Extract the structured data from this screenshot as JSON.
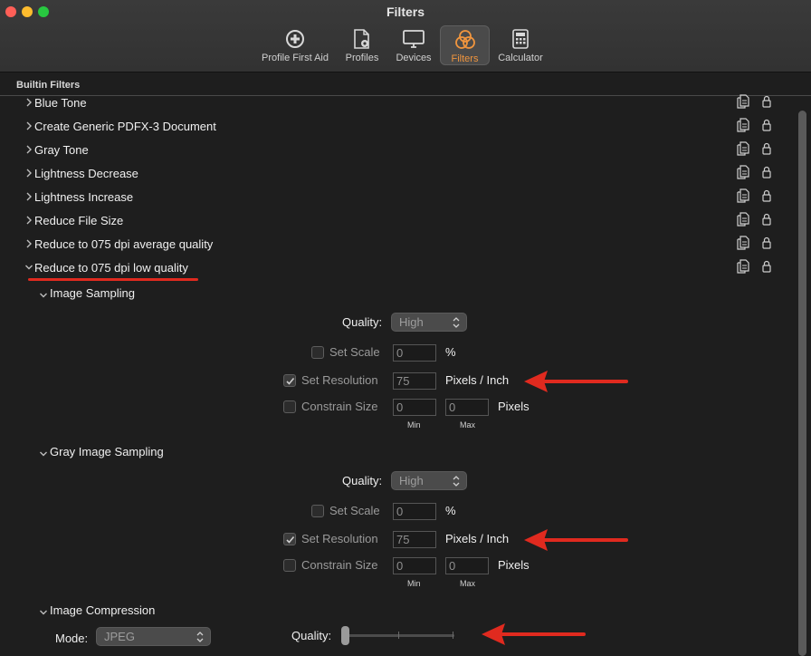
{
  "window": {
    "title": "Filters"
  },
  "toolbar": {
    "items": [
      {
        "label": "Profile First Aid",
        "icon": "plus-circle-icon"
      },
      {
        "label": "Profiles",
        "icon": "document-gear-icon"
      },
      {
        "label": "Devices",
        "icon": "monitor-icon"
      },
      {
        "label": "Filters",
        "icon": "filters-circles-icon",
        "active": true
      },
      {
        "label": "Calculator",
        "icon": "calculator-icon"
      }
    ],
    "accent_color": "#f0953e"
  },
  "section": {
    "title": "Builtin Filters"
  },
  "filters": [
    {
      "name": "Blue Tone",
      "expanded": false
    },
    {
      "name": "Create Generic PDFX-3 Document",
      "expanded": false
    },
    {
      "name": "Gray Tone",
      "expanded": false
    },
    {
      "name": "Lightness Decrease",
      "expanded": false
    },
    {
      "name": "Lightness Increase",
      "expanded": false
    },
    {
      "name": "Reduce File Size",
      "expanded": false
    },
    {
      "name": "Reduce to 075 dpi average quality",
      "expanded": false
    },
    {
      "name": "Reduce to 075 dpi low quality",
      "expanded": true
    }
  ],
  "image_sampling": {
    "title": "Image Sampling",
    "quality_label": "Quality:",
    "quality_value": "High",
    "set_scale_label": "Set Scale",
    "set_scale_checked": false,
    "set_scale_value": "0",
    "set_scale_unit": "%",
    "set_resolution_label": "Set Resolution",
    "set_resolution_checked": true,
    "set_resolution_value": "75",
    "set_resolution_unit": "Pixels / Inch",
    "constrain_label": "Constrain Size",
    "constrain_checked": false,
    "constrain_min": "0",
    "constrain_max": "0",
    "constrain_unit": "Pixels",
    "min_label": "Min",
    "max_label": "Max"
  },
  "gray_image_sampling": {
    "title": "Gray Image Sampling",
    "quality_label": "Quality:",
    "quality_value": "High",
    "set_scale_label": "Set Scale",
    "set_scale_checked": false,
    "set_scale_value": "0",
    "set_scale_unit": "%",
    "set_resolution_label": "Set Resolution",
    "set_resolution_checked": true,
    "set_resolution_value": "75",
    "set_resolution_unit": "Pixels / Inch",
    "constrain_label": "Constrain Size",
    "constrain_checked": false,
    "constrain_min": "0",
    "constrain_max": "0",
    "constrain_unit": "Pixels",
    "min_label": "Min",
    "max_label": "Max"
  },
  "image_compression": {
    "title": "Image Compression",
    "mode_label": "Mode:",
    "mode_value": "JPEG",
    "quality_label": "Quality:",
    "quality_slider_value": 0
  },
  "annotation_color": "#e02a1f"
}
